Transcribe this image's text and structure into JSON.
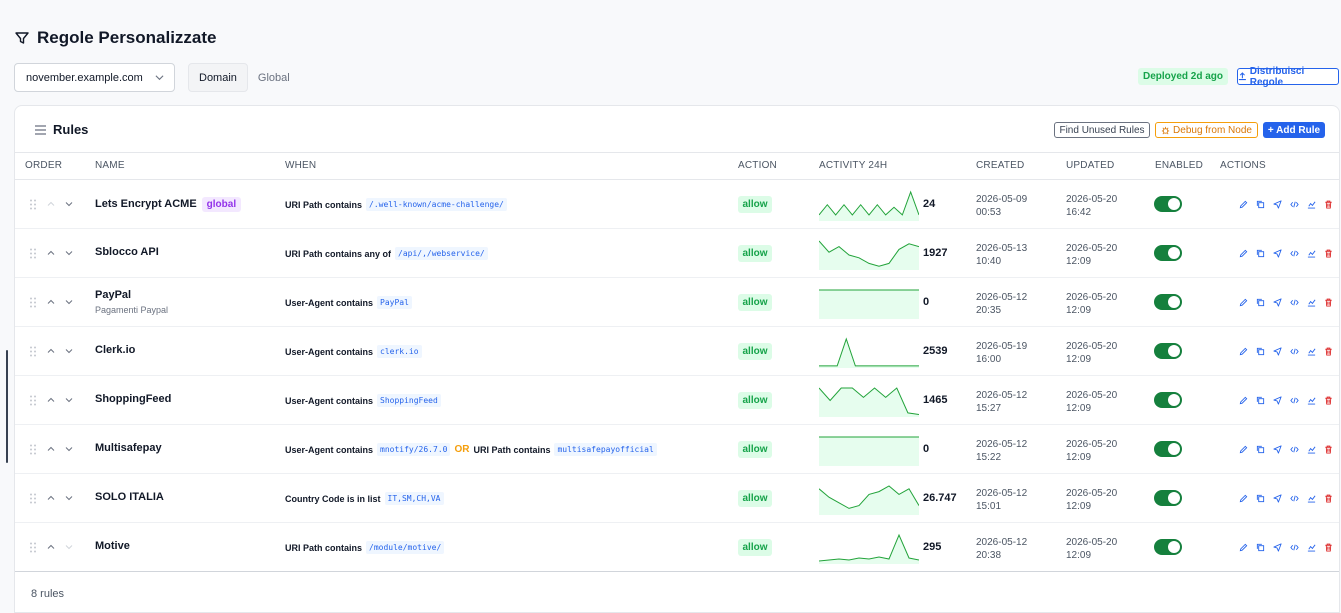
{
  "page": {
    "title": "Regole Personalizzate"
  },
  "domain_select": {
    "value": "november.example.com"
  },
  "scope_tabs": [
    {
      "label": "Domain",
      "active": true
    },
    {
      "label": "Global",
      "active": false
    }
  ],
  "deploy": {
    "status": "Deployed 2d ago",
    "distribute_label": "Distribuisci Regole"
  },
  "card": {
    "title": "Rules",
    "find_unused_label": "Find Unused Rules",
    "debug_label": "Debug from Node",
    "add_label": "+ Add Rule"
  },
  "columns": [
    "ORDER",
    "NAME",
    "WHEN",
    "ACTION",
    "ACTIVITY 24H",
    "CREATED",
    "UPDATED",
    "ENABLED",
    "ACTIONS"
  ],
  "rules": [
    {
      "name": "Lets Encrypt ACME",
      "badge": "global",
      "subtitle": "",
      "when": [
        {
          "t": "text",
          "v": "URI Path contains"
        },
        {
          "t": "code",
          "v": "/.well-known/acme-challenge/"
        }
      ],
      "action": "allow",
      "activity": "24",
      "spark": [
        4,
        12,
        4,
        12,
        4,
        12,
        4,
        12,
        4,
        10,
        4,
        22,
        4
      ],
      "created_date": "2026-05-09",
      "created_time": "00:53",
      "updated_date": "2026-05-20",
      "updated_time": "16:42",
      "enabled": true
    },
    {
      "name": "Sblocco API",
      "badge": "",
      "subtitle": "",
      "when": [
        {
          "t": "text",
          "v": "URI Path contains any of"
        },
        {
          "t": "code",
          "v": "/api/,/webservice/"
        }
      ],
      "action": "allow",
      "activity": "1927",
      "spark": [
        20,
        12,
        16,
        10,
        8,
        4,
        2,
        4,
        14,
        18,
        16
      ],
      "created_date": "2026-05-13",
      "created_time": "10:40",
      "updated_date": "2026-05-20",
      "updated_time": "12:09",
      "enabled": true
    },
    {
      "name": "PayPal",
      "badge": "",
      "subtitle": "Pagamenti Paypal",
      "when": [
        {
          "t": "text",
          "v": "User-Agent contains"
        },
        {
          "t": "code",
          "v": "PayPal"
        }
      ],
      "action": "allow",
      "activity": "0",
      "spark": [
        1,
        1,
        1,
        1,
        1,
        1,
        1,
        1,
        1,
        1,
        1
      ],
      "created_date": "2026-05-12",
      "created_time": "20:35",
      "updated_date": "2026-05-20",
      "updated_time": "12:09",
      "enabled": true
    },
    {
      "name": "Clerk.io",
      "badge": "",
      "subtitle": "",
      "when": [
        {
          "t": "text",
          "v": "User-Agent contains"
        },
        {
          "t": "code",
          "v": "clerk.io"
        }
      ],
      "action": "allow",
      "activity": "2539",
      "spark": [
        1,
        1,
        1,
        26,
        1,
        1,
        1,
        1,
        1,
        1,
        1,
        1
      ],
      "created_date": "2026-05-19",
      "created_time": "16:00",
      "updated_date": "2026-05-20",
      "updated_time": "12:09",
      "enabled": true
    },
    {
      "name": "ShoppingFeed",
      "badge": "",
      "subtitle": "",
      "when": [
        {
          "t": "text",
          "v": "User-Agent contains"
        },
        {
          "t": "code",
          "v": "ShoppingFeed"
        }
      ],
      "action": "allow",
      "activity": "1465",
      "spark": [
        18,
        10,
        18,
        18,
        12,
        18,
        12,
        18,
        2,
        1
      ],
      "created_date": "2026-05-12",
      "created_time": "15:27",
      "updated_date": "2026-05-20",
      "updated_time": "12:09",
      "enabled": true
    },
    {
      "name": "Multisafepay",
      "badge": "",
      "subtitle": "",
      "when": [
        {
          "t": "text",
          "v": "User-Agent contains"
        },
        {
          "t": "code",
          "v": "mnotify/26.7.0"
        },
        {
          "t": "or",
          "v": "OR"
        },
        {
          "t": "text",
          "v": "URI Path contains"
        },
        {
          "t": "code",
          "v": "multisafepayofficial"
        }
      ],
      "action": "allow",
      "activity": "0",
      "spark": [
        1,
        1,
        1,
        1,
        1,
        1,
        1,
        1,
        1,
        1,
        1
      ],
      "created_date": "2026-05-12",
      "created_time": "15:22",
      "updated_date": "2026-05-20",
      "updated_time": "12:09",
      "enabled": true
    },
    {
      "name": "SOLO ITALIA",
      "badge": "",
      "subtitle": "",
      "when": [
        {
          "t": "text",
          "v": "Country Code is in list"
        },
        {
          "t": "code",
          "v": "IT,SM,CH,VA"
        }
      ],
      "action": "allow",
      "activity": "26.747",
      "spark": [
        18,
        12,
        8,
        4,
        6,
        14,
        16,
        20,
        14,
        18,
        6
      ],
      "created_date": "2026-05-12",
      "created_time": "15:01",
      "updated_date": "2026-05-20",
      "updated_time": "12:09",
      "enabled": true
    },
    {
      "name": "Motive",
      "badge": "",
      "subtitle": "",
      "when": [
        {
          "t": "text",
          "v": "URI Path contains"
        },
        {
          "t": "code",
          "v": "/module/motive/"
        }
      ],
      "action": "allow",
      "activity": "295",
      "spark": [
        2,
        3,
        4,
        3,
        5,
        4,
        6,
        4,
        28,
        5,
        3
      ],
      "created_date": "2026-05-12",
      "created_time": "20:38",
      "updated_date": "2026-05-20",
      "updated_time": "12:09",
      "enabled": true
    }
  ],
  "footer": {
    "count": "8 rules"
  },
  "colors": {
    "primary": "#2563eb",
    "success": "#16a34a",
    "toggle": "#15803d",
    "warning": "#f59e0b",
    "danger": "#dc2626"
  }
}
